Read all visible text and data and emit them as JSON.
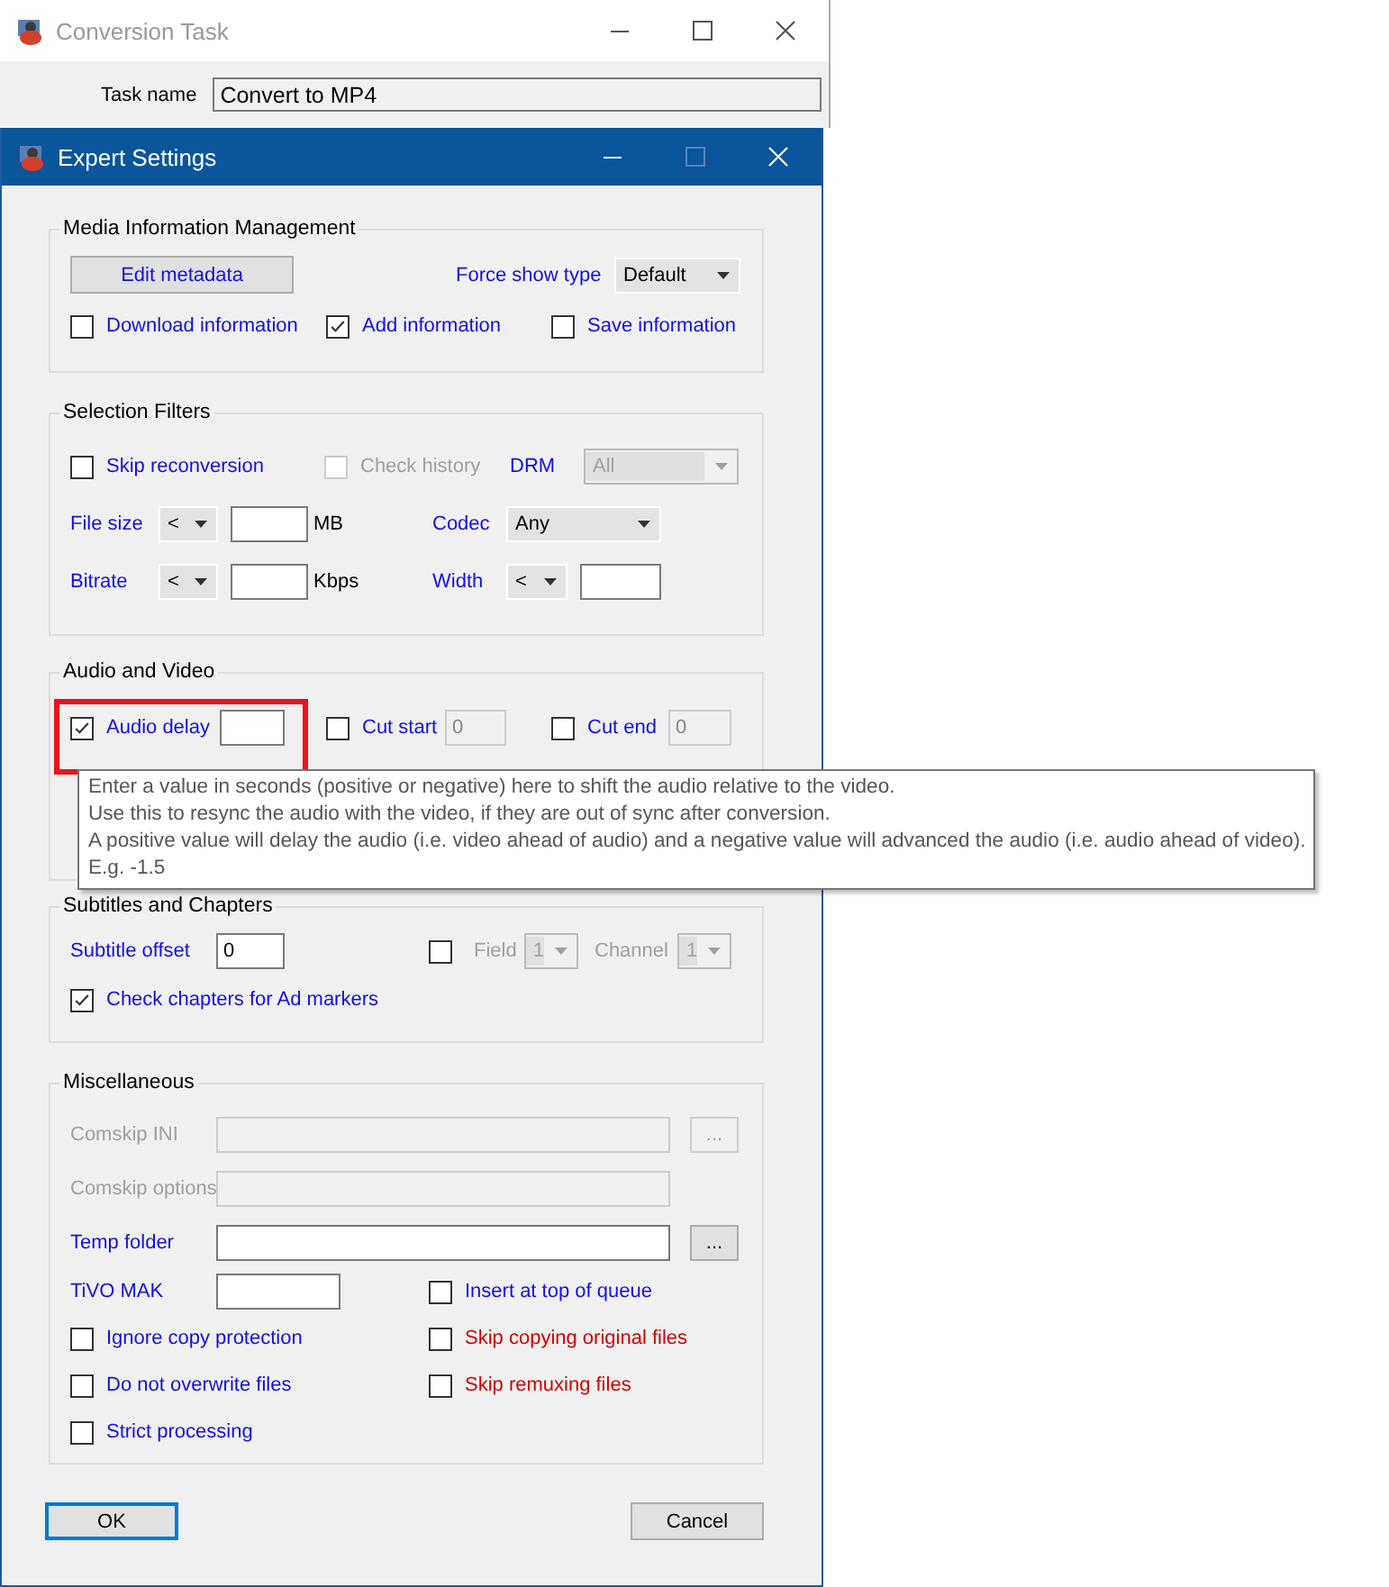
{
  "background_window": {
    "title": "Conversion Task",
    "task_name_label": "Task name",
    "task_name_value": "Convert to MP4"
  },
  "dialog": {
    "title": "Expert Settings"
  },
  "media_info": {
    "title": "Media Information Management",
    "edit_button": "Edit metadata",
    "force_show_type": {
      "label": "Force show type",
      "value": "Default"
    },
    "checkboxes": [
      {
        "label": "Download information",
        "checked": false
      },
      {
        "label": "Add information",
        "checked": true
      },
      {
        "label": "Save information",
        "checked": false
      }
    ]
  },
  "selection_filters": {
    "title": "Selection Filters",
    "skip_reconversion": {
      "label": "Skip reconversion",
      "checked": false
    },
    "check_history": {
      "label": "Check history",
      "checked": false,
      "disabled": true
    },
    "drm": {
      "label": "DRM",
      "value": "All",
      "disabled": true
    },
    "file_size": {
      "label": "File size",
      "operator": "<",
      "unit": "MB"
    },
    "codec": {
      "label": "Codec",
      "value": "Any",
      "disabled": false
    },
    "bitrate": {
      "label": "Bitrate",
      "operator": "<",
      "unit": "Kbps"
    },
    "width": {
      "label": "Width",
      "operator": "<"
    }
  },
  "audio_video": {
    "title": "Audio and Video",
    "audio_delay": {
      "label": "Audio delay",
      "checked": true,
      "highlighted": true
    },
    "cut_start": {
      "label": "Cut start",
      "checked": false,
      "value": "0",
      "disabled": true
    },
    "cut_end": {
      "label": "Cut end",
      "checked": false,
      "value": "0",
      "disabled": true
    }
  },
  "tooltip": {
    "lines": [
      "Enter a value in seconds (positive or negative) here to shift the audio relative to the video.",
      "Use this to resync the audio with the video, if they are out of sync after conversion.",
      "A positive value will delay the audio (i.e. video ahead of audio) and a negative value will advanced the audio (i.e. audio ahead of video).",
      "E.g. -1.5"
    ]
  },
  "subtitles": {
    "title": "Subtitles and Chapters",
    "subtitle_offset": {
      "label": "Subtitle offset",
      "value": "0"
    },
    "closed_captions": {
      "checked": false,
      "field": {
        "label": "Field",
        "value": "1",
        "disabled": true
      },
      "channel": {
        "label": "Channel",
        "value": "1",
        "disabled": true
      }
    },
    "check_chapters": {
      "label": "Check chapters for Ad markers",
      "checked": true
    }
  },
  "misc": {
    "title": "Miscellaneous",
    "fields": [
      {
        "label": "Comskip INI",
        "disabled": true,
        "browse": "..."
      },
      {
        "label": "Comskip options",
        "disabled": true
      },
      {
        "label": "Temp folder",
        "disabled": false,
        "browse": "..."
      }
    ],
    "tivo_mak": {
      "label": "TiVO MAK"
    },
    "left_checkboxes": [
      {
        "label": "Ignore copy protection",
        "checked": false,
        "warning": false
      },
      {
        "label": "Do not overwrite files",
        "checked": false,
        "warning": false
      },
      {
        "label": "Strict processing",
        "checked": false,
        "warning": false
      }
    ],
    "right_checkboxes": [
      {
        "label": "Insert at top of queue",
        "checked": false,
        "warning": false
      },
      {
        "label": "Skip copying original files",
        "checked": false,
        "warning": true
      },
      {
        "label": "Skip remuxing files",
        "checked": false,
        "warning": true
      }
    ]
  },
  "buttons": [
    {
      "label": "OK",
      "default": true
    },
    {
      "label": "Cancel",
      "default": false
    }
  ]
}
